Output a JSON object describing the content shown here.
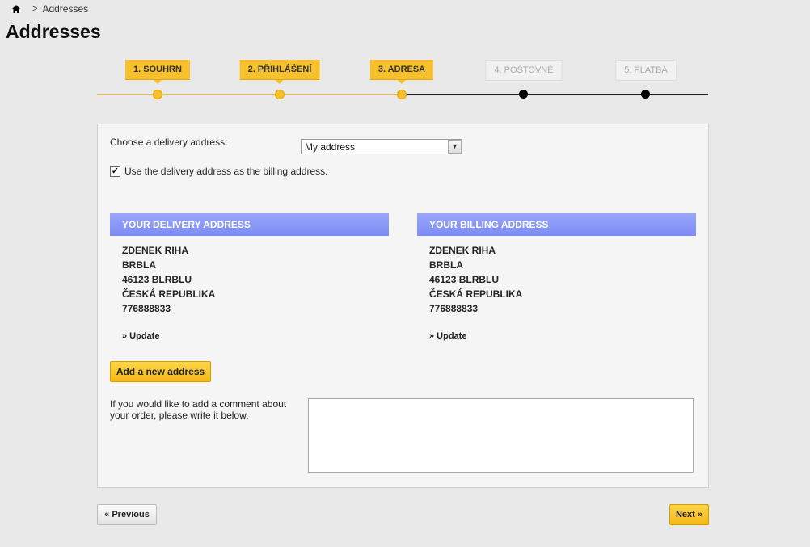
{
  "breadcrumb": {
    "home_icon": "home-icon",
    "separator": ">",
    "current": "Addresses"
  },
  "page": {
    "title": "Addresses"
  },
  "steps": [
    {
      "label": "1. SOUHRN",
      "state": "done"
    },
    {
      "label": "2. PŘIHLÁŠENÍ",
      "state": "done"
    },
    {
      "label": "3. ADRESA",
      "state": "current"
    },
    {
      "label": "4. POŠTOVNÉ",
      "state": "pending"
    },
    {
      "label": "5. PLATBA",
      "state": "pending"
    }
  ],
  "form": {
    "choose_label": "Choose a delivery address:",
    "selected_address": "My address",
    "same_billing_label": "Use the delivery address as the billing address.",
    "same_billing_checked": true
  },
  "delivery": {
    "heading": "YOUR DELIVERY ADDRESS",
    "lines": [
      "ZDENEK RIHA",
      "BRBLA",
      "46123 BLRBLU",
      "ČESKÁ REPUBLIKA",
      "776888833"
    ],
    "update": "» Update"
  },
  "billing": {
    "heading": "YOUR BILLING ADDRESS",
    "lines": [
      "ZDENEK RIHA",
      "BRBLA",
      "46123 BLRBLU",
      "ČESKÁ REPUBLIKA",
      "776888833"
    ],
    "update": "» Update"
  },
  "actions": {
    "add_address": "Add a new address",
    "previous": "« Previous",
    "next": "Next »"
  },
  "comment": {
    "label": "If you would like to add a comment about your order, please write it below.",
    "value": ""
  },
  "colors": {
    "accent": "#f7c12d",
    "header_blue": "#8a98f7"
  }
}
